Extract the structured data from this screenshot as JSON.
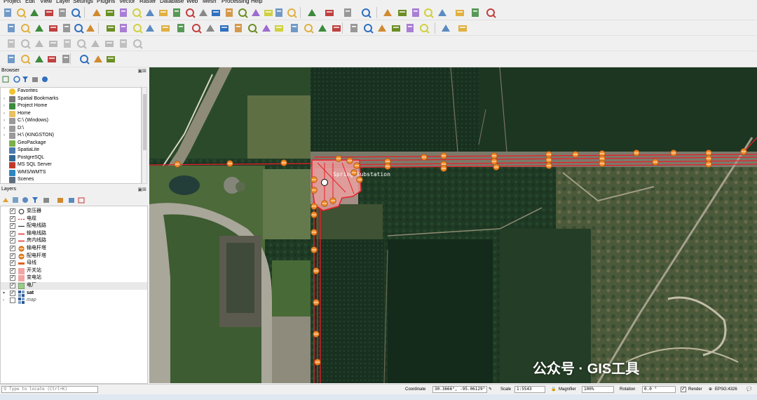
{
  "menu": [
    "Project",
    "Edit",
    "View",
    "Layer",
    "Settings",
    "Plugins",
    "Vector",
    "Raster",
    "Database",
    "Web",
    "Mesh",
    "Processing",
    "Help"
  ],
  "browser": {
    "title": "Browser",
    "items": [
      {
        "label": "Favorites",
        "icon": "star-icon"
      },
      {
        "label": "Spatial Bookmarks",
        "icon": "bookmark-icon"
      },
      {
        "label": "Project Home",
        "icon": "project-home-icon"
      },
      {
        "label": "Home",
        "icon": "folder-icon"
      },
      {
        "label": "C:\\ (Windows)",
        "icon": "drive-icon"
      },
      {
        "label": "D:\\",
        "icon": "drive-icon"
      },
      {
        "label": "H:\\ (KINGSTON)",
        "icon": "drive-icon"
      },
      {
        "label": "GeoPackage",
        "icon": "geopackage-icon"
      },
      {
        "label": "SpatiaLite",
        "icon": "spatialite-icon"
      },
      {
        "label": "PostgreSQL",
        "icon": "postgresql-icon"
      },
      {
        "label": "MS SQL Server",
        "icon": "mssql-icon"
      },
      {
        "label": "WMS/WMTS",
        "icon": "wms-icon"
      },
      {
        "label": "Scenes",
        "icon": "scenes-icon"
      }
    ]
  },
  "layers": {
    "title": "Layers",
    "items": [
      {
        "label": "变压器",
        "checked": true,
        "symbol": "circle"
      },
      {
        "label": "电缆",
        "checked": true,
        "symbol": "dash"
      },
      {
        "label": "配电线路",
        "checked": true,
        "symbol": "line"
      },
      {
        "label": "输电线路",
        "checked": true,
        "symbol": "line-red"
      },
      {
        "label": "房内线路",
        "checked": true,
        "symbol": "line-red"
      },
      {
        "label": "输电杆塔",
        "checked": true,
        "symbol": "tower"
      },
      {
        "label": "配电杆塔",
        "checked": true,
        "symbol": "tower"
      },
      {
        "label": "母线",
        "checked": true,
        "symbol": "bus"
      },
      {
        "label": "开关站",
        "checked": true,
        "symbol": "fill-pink"
      },
      {
        "label": "变电站",
        "checked": true,
        "symbol": "fill-pink"
      },
      {
        "label": "电厂",
        "checked": true,
        "symbol": "fill-green"
      },
      {
        "label": "sat",
        "checked": true,
        "symbol": "raster"
      },
      {
        "label": "map",
        "checked": false,
        "symbol": "raster"
      }
    ]
  },
  "map": {
    "substation_label": "Spring Substation"
  },
  "status": {
    "locate_placeholder": "Type to locate (Ctrl+K)",
    "coordinate_label": "Coordinate",
    "coordinate_value": "30.3666°, -95.06129°",
    "scale_label": "Scale",
    "scale_value": "1:5543",
    "magnifier_label": "Magnifier",
    "magnifier_value": "100%",
    "rotation_label": "Rotation",
    "rotation_value": "0.0 °",
    "render_label": "Render",
    "crs_label": "EPSG:4326"
  },
  "watermark": "公众号 · GIS工具",
  "colors": {
    "accent": "#d73027",
    "tower": "#f28c28",
    "substation": "#f4a3a3"
  }
}
